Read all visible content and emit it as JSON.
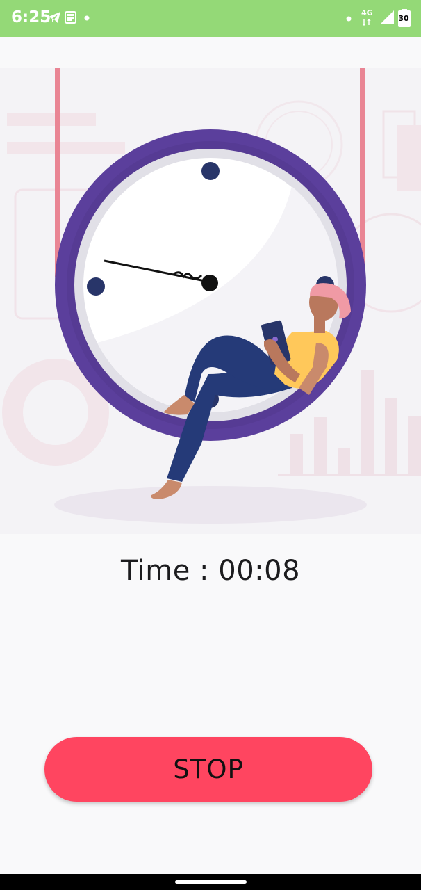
{
  "status_bar": {
    "time": "6:25",
    "network": "4G",
    "battery_level": "30",
    "icons": [
      "telegram-icon",
      "news-icon",
      "notification-dot-icon",
      "signal-icon",
      "battery-icon"
    ],
    "background_color": "#94d977"
  },
  "illustration": {
    "subject": "woman-reading-tablet-on-clock-swing",
    "colors": {
      "clock_ring": "#5b3f9c",
      "dots": "#283569",
      "ropes": "#e98594",
      "shirt": "#ffc85a",
      "pants": "#253a78",
      "hair": "#f09aa5"
    }
  },
  "timer": {
    "label": "Time : 00:08"
  },
  "stop_button": {
    "label": "STOP",
    "color": "#ff4560"
  }
}
